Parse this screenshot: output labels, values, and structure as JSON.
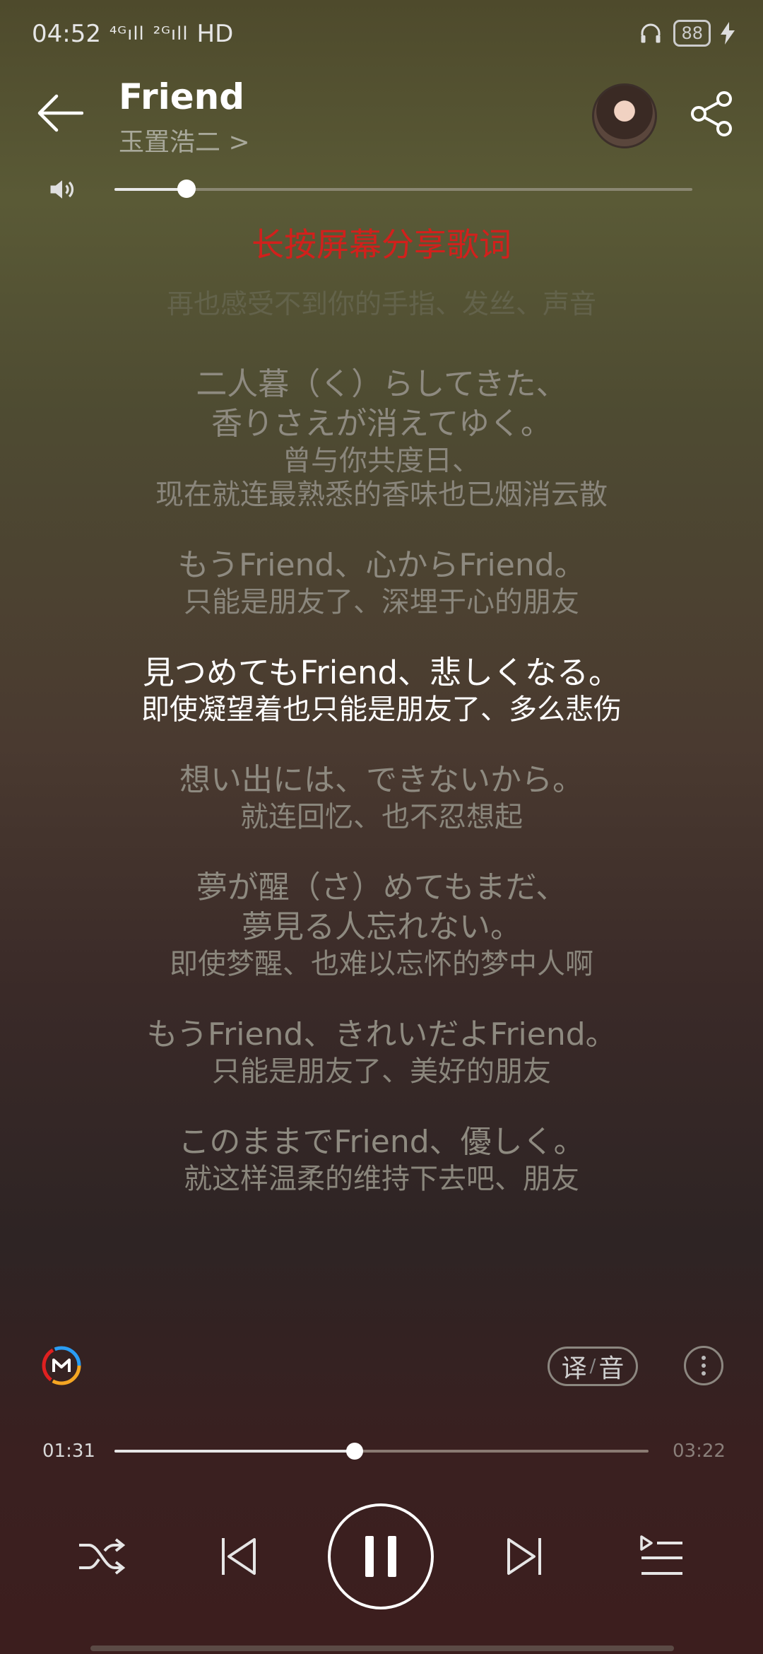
{
  "status": {
    "time": "04:52",
    "signal1": "⁴ᴳıll",
    "signal2": "²ᴳıll",
    "hd": "HD",
    "battery": "88"
  },
  "header": {
    "title": "Friend",
    "artist": "玉置浩二",
    "artist_chevron": ">"
  },
  "volume": {
    "level_percent": 12.5
  },
  "share_hint": "长按屏幕分享歌词",
  "lyrics": {
    "previous_line": "再也感受不到你的手指、发丝、声音",
    "stanzas": [
      {
        "jp": [
          "二人暮（く）らしてきた、",
          "香りさえが消えてゆく。"
        ],
        "cn": [
          "曾与你共度日、",
          "现在就连最熟悉的香味也已烟消云散"
        ],
        "active": false
      },
      {
        "jp": [
          "もうFriend、心からFriend。"
        ],
        "cn": [
          "只能是朋友了、深埋于心的朋友"
        ],
        "active": false
      },
      {
        "jp": [
          "見つめてもFriend、悲しくなる。"
        ],
        "cn": [
          "即使凝望着也只能是朋友了、多么悲伤"
        ],
        "active": true
      },
      {
        "jp": [
          "想い出には、できないから。"
        ],
        "cn": [
          "就连回忆、也不忍想起"
        ],
        "active": false
      },
      {
        "jp": [
          "夢が醒（さ）めてもまだ、",
          "夢見る人忘れない。"
        ],
        "cn": [
          "即使梦醒、也难以忘怀的梦中人啊"
        ],
        "active": false
      },
      {
        "jp": [
          "もうFriend、きれいだよFriend。"
        ],
        "cn": [
          "只能是朋友了、美好的朋友"
        ],
        "active": false
      },
      {
        "jp": [
          "このままでFriend、優しく。"
        ],
        "cn": [
          "就这样温柔的维持下去吧、朋友"
        ],
        "active": false
      }
    ]
  },
  "controls": {
    "translate_label": "译",
    "separator": "/",
    "phonetic_label": "音",
    "elapsed": "01:31",
    "duration": "03:22",
    "progress_percent": 45
  },
  "icons": [
    "back-arrow-icon",
    "share-icon",
    "volume-icon",
    "music-m-icon",
    "more-icon",
    "shuffle-icon",
    "previous-icon",
    "pause-icon",
    "next-icon",
    "playlist-icon",
    "headphones-icon",
    "charging-icon"
  ]
}
